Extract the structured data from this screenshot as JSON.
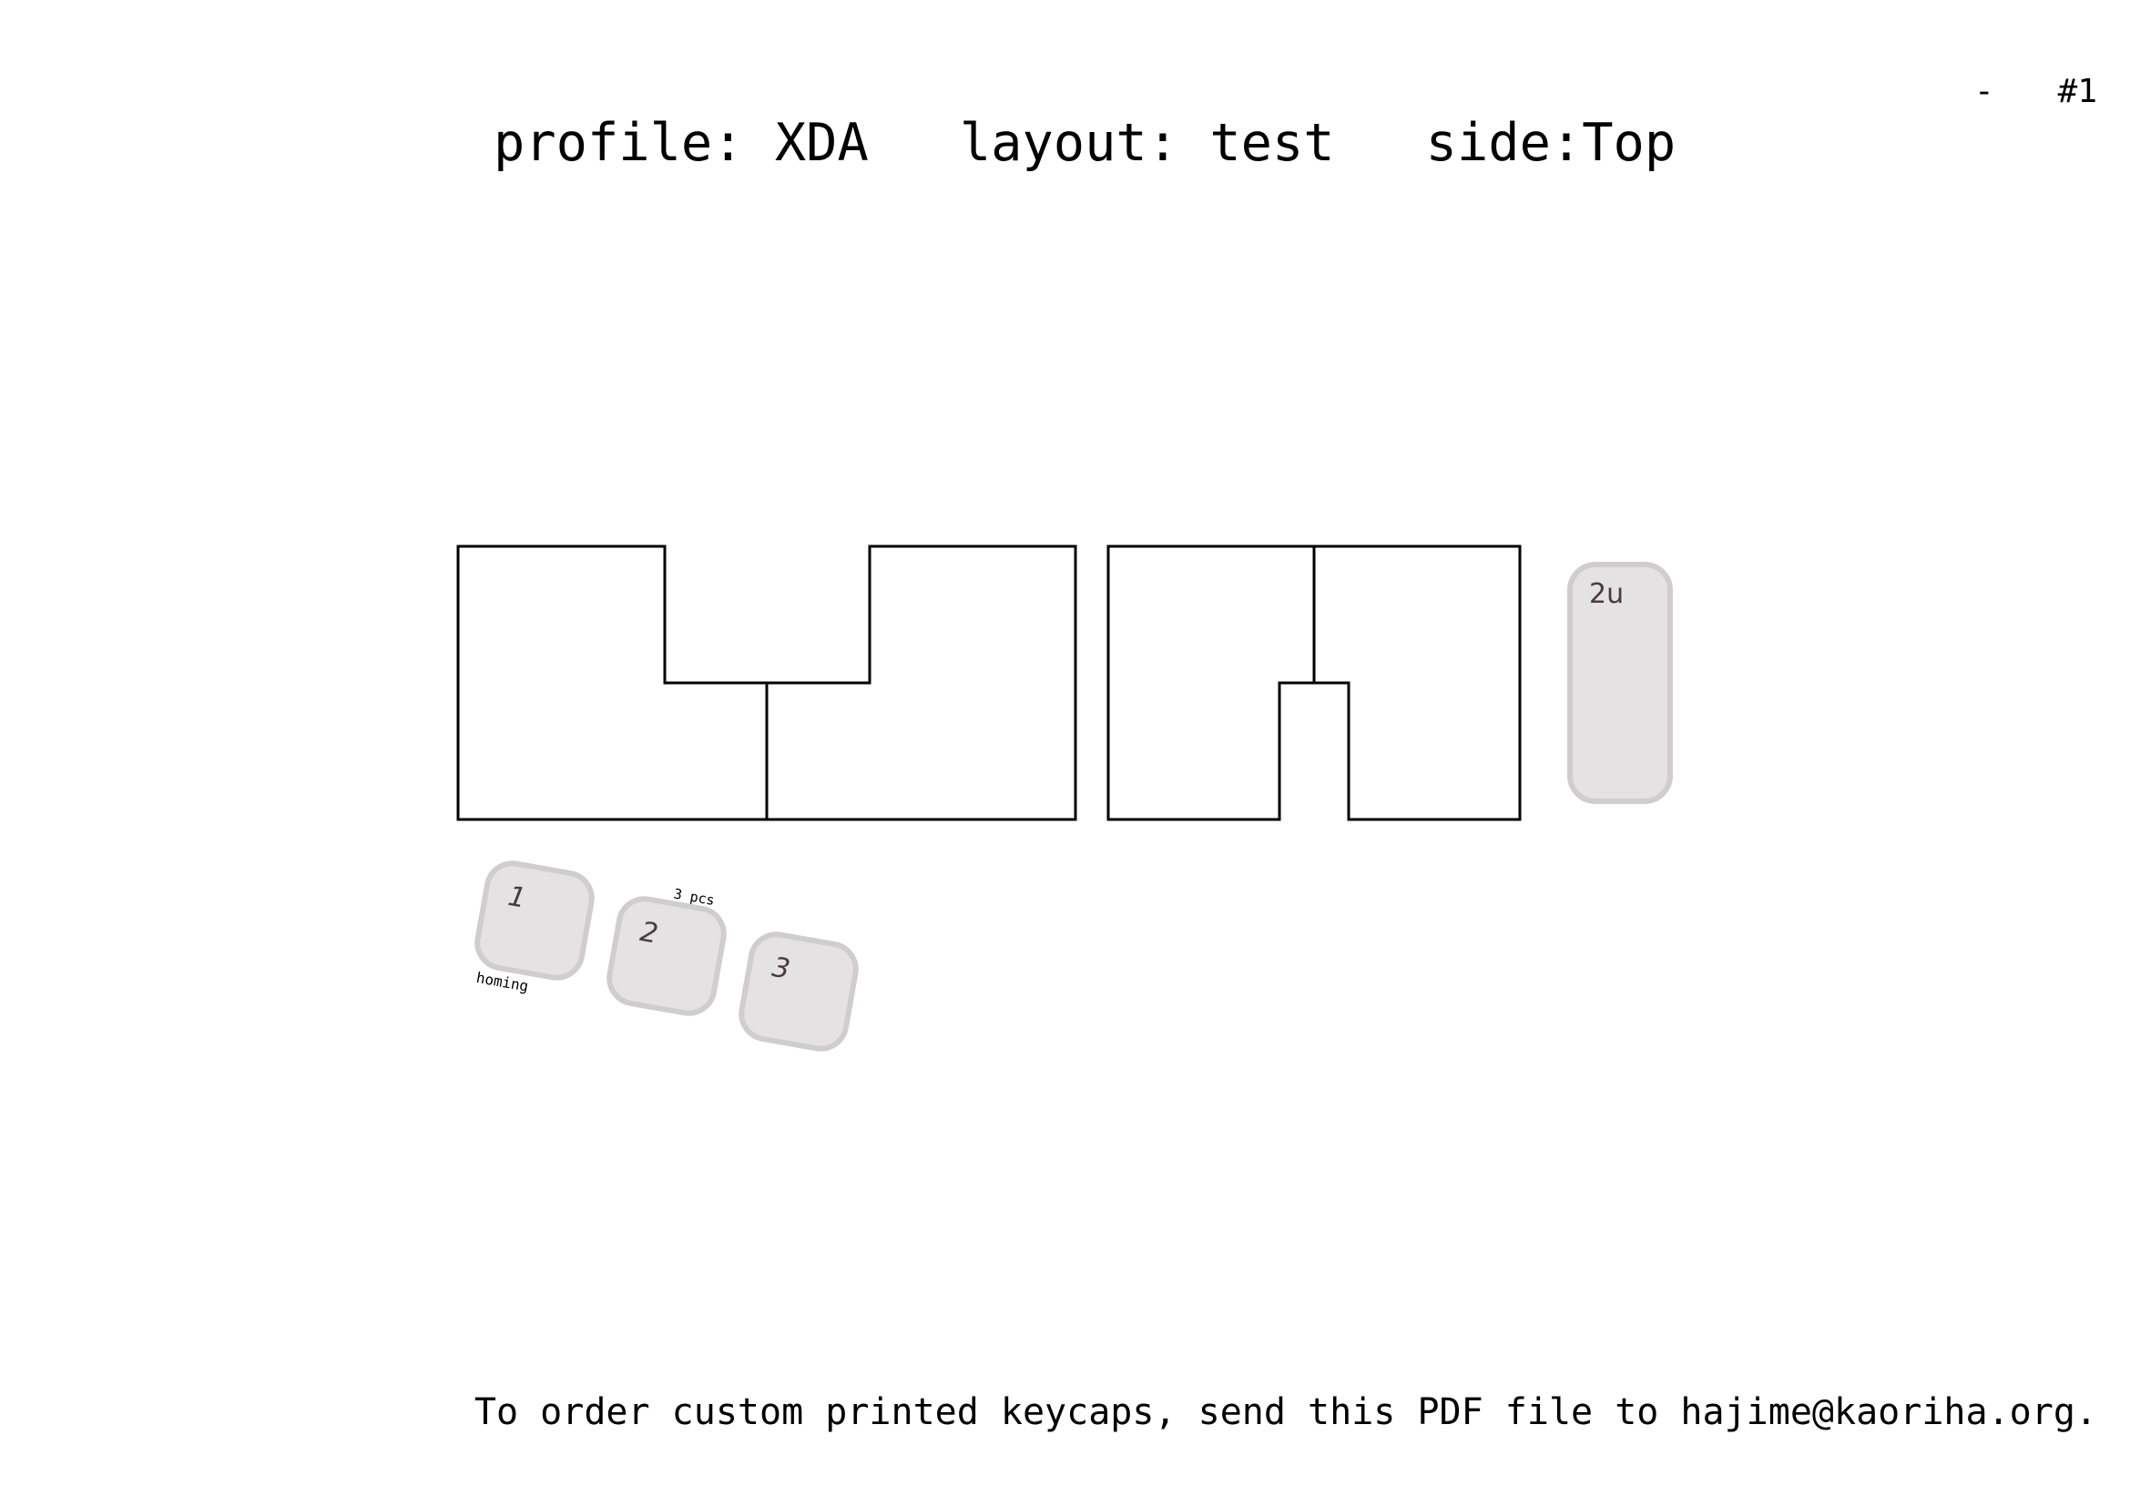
{
  "page": {
    "dash": "-",
    "page_number": "#1"
  },
  "header": {
    "profile": "profile: XDA",
    "layout": "layout: test",
    "side": "side:Top"
  },
  "keycaps": [
    {
      "legend": "1",
      "note": "homing"
    },
    {
      "legend": "2",
      "note": "3 pcs"
    },
    {
      "legend": "3",
      "note": ""
    },
    {
      "legend": "2u",
      "note": ""
    }
  ],
  "footer": {
    "text": "To order custom printed keycaps, send this PDF file to hajime@kaoriha.org."
  },
  "colors": {
    "keycap_fill": "#e4e2e3",
    "keycap_stroke": "#cfcdce",
    "legend": "#4a3a40",
    "outline": "#000000"
  }
}
